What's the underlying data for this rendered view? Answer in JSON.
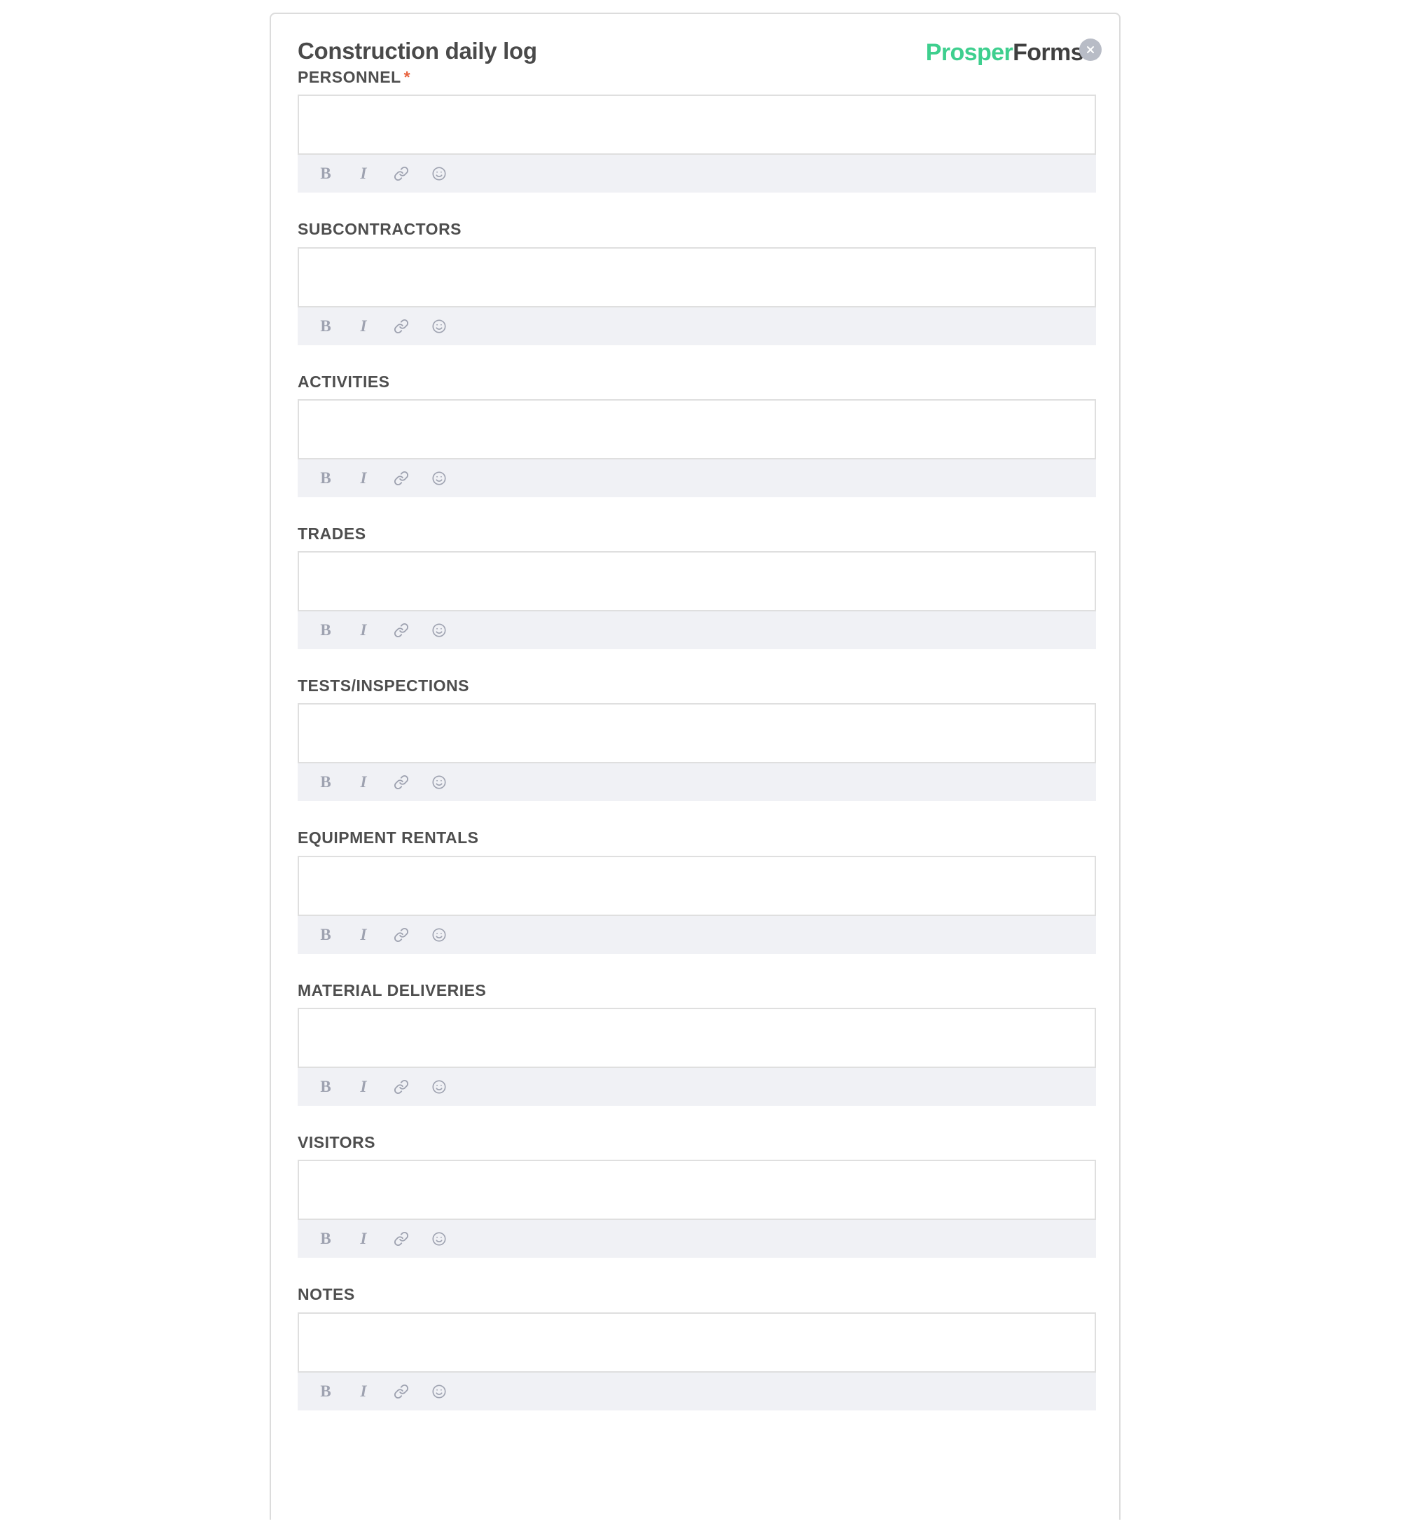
{
  "header": {
    "title": "Construction daily log",
    "brand_prosper": "Prosper",
    "brand_forms": "Forms",
    "close_label": "×"
  },
  "colors": {
    "brand_green": "#3ecf8e",
    "brand_dark": "#3f3f3f",
    "required_star": "#e8613c",
    "label_text": "#4e4e4e",
    "toolbar_bg": "#f0f1f5",
    "toolbar_icon": "#9ea2b0",
    "field_border": "#dfdfdf",
    "card_border": "#dcdcdc",
    "close_circle": "#b8bcc6"
  },
  "toolbar": {
    "bold_label": "B",
    "italic_label": "I",
    "bold_name": "bold",
    "italic_name": "italic",
    "link_name": "link",
    "emoji_name": "emoji"
  },
  "fields": [
    {
      "label": "PERSONNEL",
      "required": true,
      "star": "*",
      "value": "",
      "placeholder": ""
    },
    {
      "label": "SUBCONTRACTORS",
      "required": false,
      "star": "",
      "value": "",
      "placeholder": ""
    },
    {
      "label": "ACTIVITIES",
      "required": false,
      "star": "",
      "value": "",
      "placeholder": ""
    },
    {
      "label": "TRADES",
      "required": false,
      "star": "",
      "value": "",
      "placeholder": ""
    },
    {
      "label": "TESTS/INSPECTIONS",
      "required": false,
      "star": "",
      "value": "",
      "placeholder": ""
    },
    {
      "label": "EQUIPMENT RENTALS",
      "required": false,
      "star": "",
      "value": "",
      "placeholder": ""
    },
    {
      "label": "MATERIAL DELIVERIES",
      "required": false,
      "star": "",
      "value": "",
      "placeholder": ""
    },
    {
      "label": "VISITORS",
      "required": false,
      "star": "",
      "value": "",
      "placeholder": ""
    },
    {
      "label": "NOTES",
      "required": false,
      "star": "",
      "value": "",
      "placeholder": ""
    }
  ]
}
